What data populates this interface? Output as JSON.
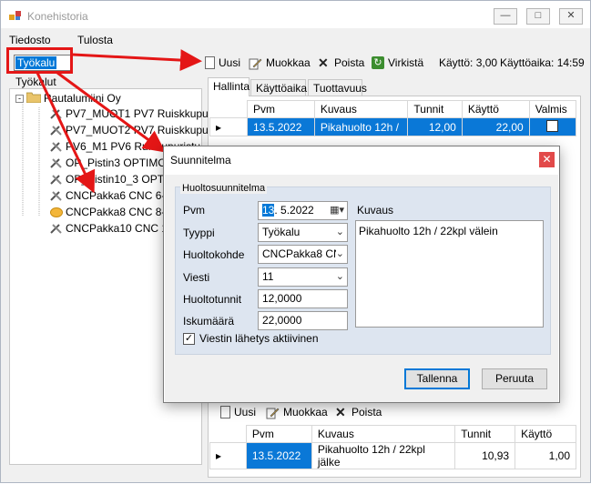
{
  "window": {
    "title": "Konehistoria"
  },
  "menu": {
    "file": "Tiedosto",
    "print": "Tulosta"
  },
  "toolbar": {
    "selector_value": "Työkalu",
    "new": "Uusi",
    "edit": "Muokkaa",
    "delete": "Poista",
    "refresh": "Virkistä",
    "usage": "Käyttö: 3,00",
    "usage_time": "Käyttöaika: 14:59"
  },
  "tree": {
    "header": "Työkalut",
    "root": "Rautalumiini Oy",
    "items": [
      "PV7_MUOT1 PV7 Ruiskkupu",
      "PV7_MUOT2 PV7 Ruiskkupu",
      "PV6_M1 PV6 Ruiskupuristu",
      "OP_Pistin3 OPTIMO le",
      "OP_Pistin10_3 OPTIMO",
      "CNCPakka6 CNC 6-Re",
      "CNCPakka8 CNC 8-Re",
      "CNCPakka10 CNC 10"
    ]
  },
  "tabs": [
    "Hallinta",
    "Käyttöaika",
    "Tuottavuus"
  ],
  "top_grid": {
    "headers": [
      "Pvm",
      "Kuvaus",
      "Tunnit",
      "Käyttö",
      "Valmis"
    ],
    "rows": [
      {
        "pvm": "13.5.2022",
        "kuvaus": "Pikahuolto 12h /",
        "tunnit": "12,00",
        "kaytto": "22,00"
      }
    ]
  },
  "dialog": {
    "title": "Suunnitelma",
    "group": "Huoltosuunnitelma",
    "labels": {
      "pvm": "Pvm",
      "tyyppi": "Tyyppi",
      "kohde": "Huoltokohde",
      "viesti": "Viesti",
      "tunnit": "Huoltotunnit",
      "isku": "Iskumäärä",
      "kuvaus": "Kuvaus"
    },
    "values": {
      "pvm_day": "13",
      "pvm_rest": ". 5.2022",
      "tyyppi": "Työkalu",
      "kohde": "CNCPakka8 CN",
      "viesti": "11",
      "tunnit": "12,0000",
      "isku": "22,0000",
      "kuvaus": "Pikahuolto 12h / 22kpl välein"
    },
    "checkbox_label": "Viestin lähetys aktiivinen",
    "save": "Tallenna",
    "cancel": "Peruuta"
  },
  "bottom_toolbar": {
    "new": "Uusi",
    "edit": "Muokkaa",
    "delete": "Poista"
  },
  "bottom_grid": {
    "headers": [
      "Pvm",
      "Kuvaus",
      "Tunnit",
      "Käyttö"
    ],
    "rows": [
      {
        "pvm": "13.5.2022",
        "kuvaus": "Pikahuolto 12h / 22kpl jälke",
        "tunnit": "10,93",
        "kaytto": "1,00"
      }
    ]
  },
  "colors": {
    "accent": "#0078d7",
    "highlight": "#e41616",
    "selection": "#0a78d7"
  }
}
